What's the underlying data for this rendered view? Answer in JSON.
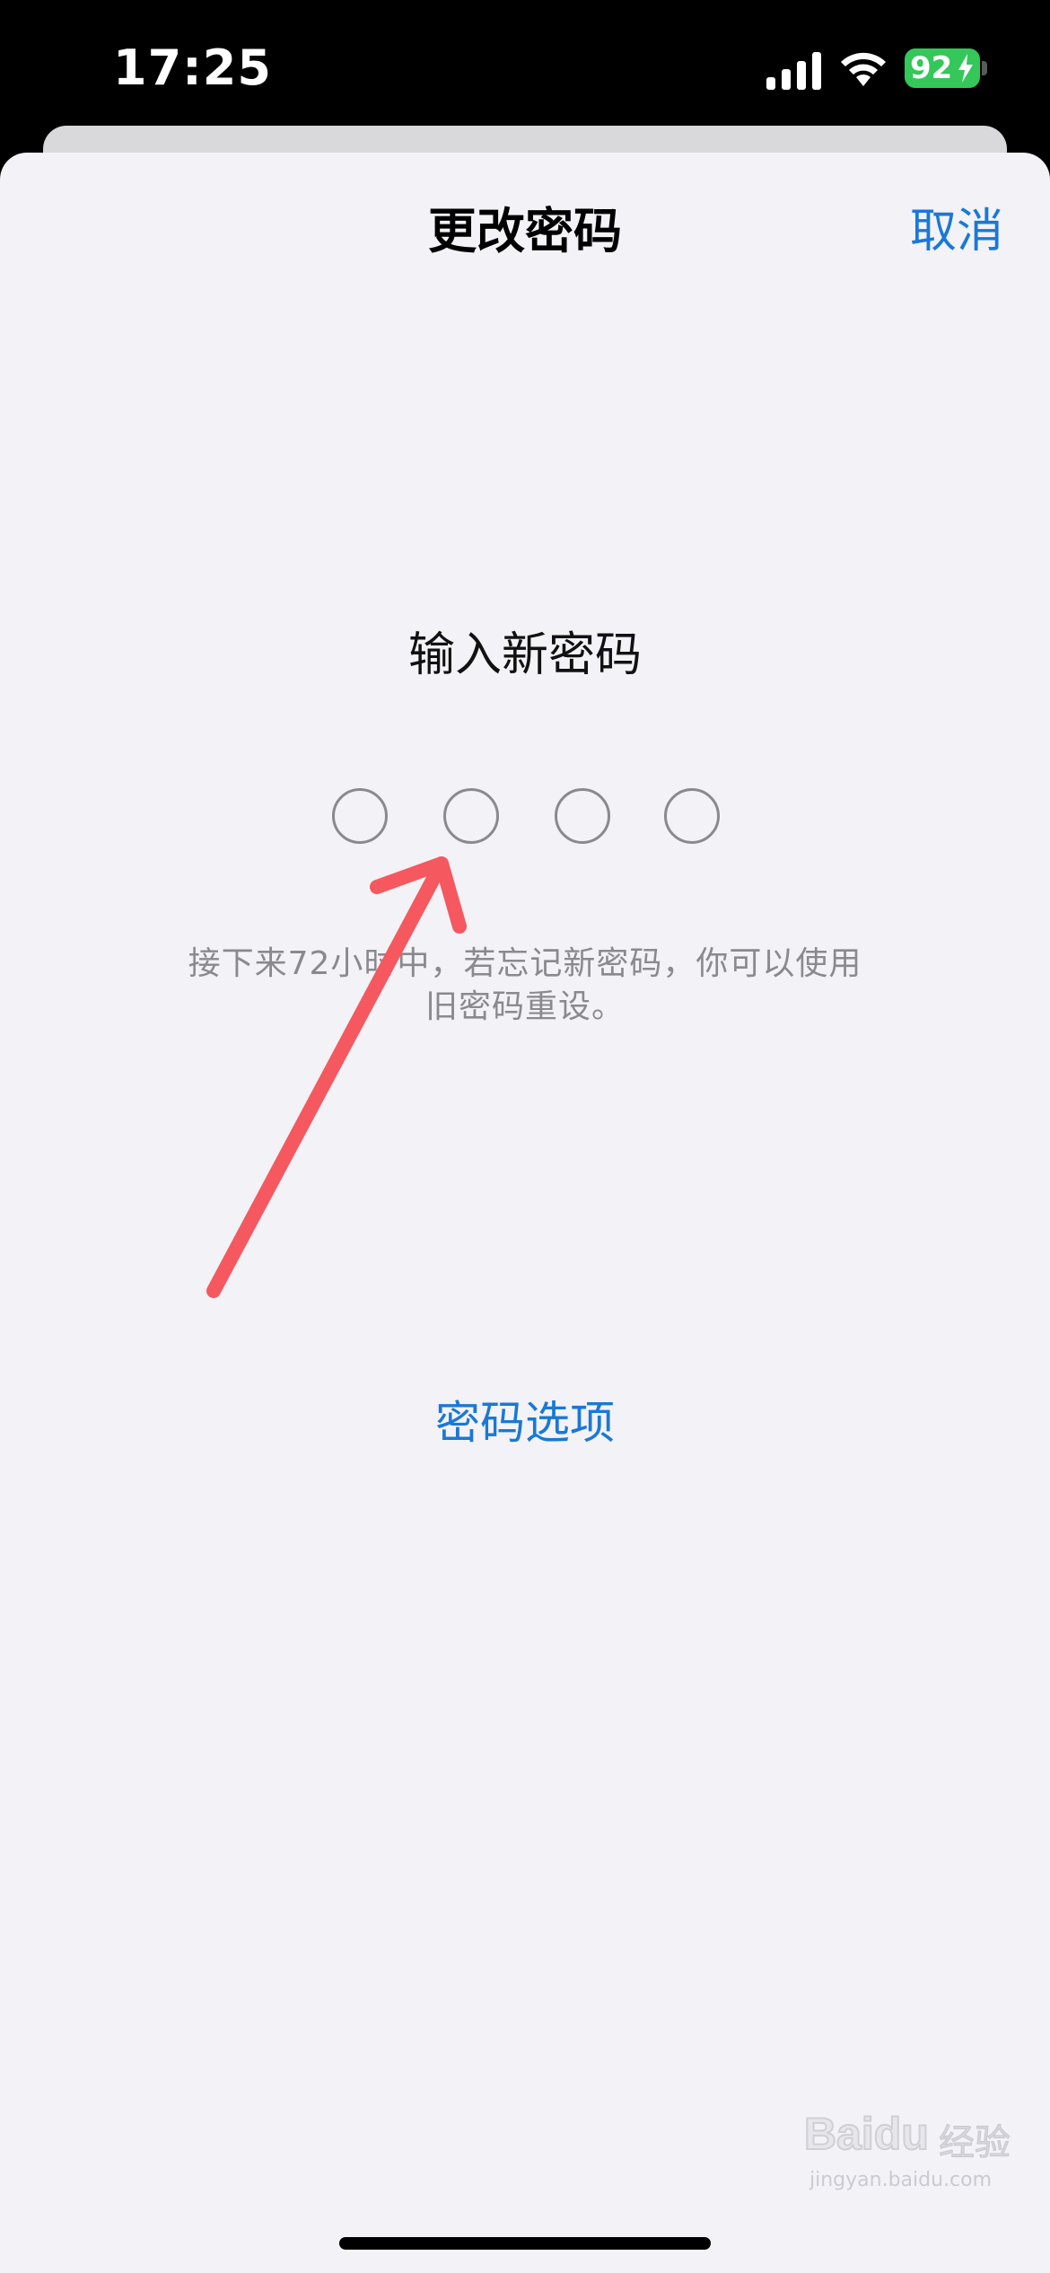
{
  "status_bar": {
    "time": "17:25",
    "battery": "92",
    "icons": [
      "signal-icon",
      "wifi-icon",
      "battery-charging-icon"
    ]
  },
  "sheet": {
    "title": "更改密码",
    "cancel_label": "取消",
    "prompt": "输入新密码",
    "passcode_length": 4,
    "hint_line1": "接下来72小时中，若忘记新密码，你可以使用",
    "hint_line2": "旧密码重设。",
    "options_label": "密码选项"
  },
  "annotation": {
    "arrow_color": "#f5585f"
  },
  "watermark": {
    "logo": "Baidu",
    "brand": "经验",
    "url": "jingyan.baidu.com"
  },
  "colors": {
    "accent": "#1a78d6",
    "sheet_background": "#f2f2f7",
    "battery": "#34c759"
  }
}
